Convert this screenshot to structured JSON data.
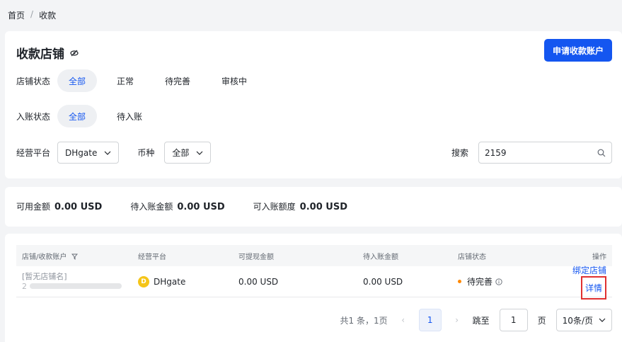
{
  "breadcrumb": {
    "home": "首页",
    "sep": "/",
    "current": "收款"
  },
  "header": {
    "title": "收款店铺",
    "apply_label": "申请收款账户"
  },
  "filters": {
    "shop_status_label": "店铺状态",
    "shop_status_options": [
      "全部",
      "正常",
      "待完善",
      "审核中"
    ],
    "entry_status_label": "入账状态",
    "entry_status_options": [
      "全部",
      "待入账"
    ],
    "platform_label": "经营平台",
    "platform_value": "DHgate",
    "currency_label": "币种",
    "currency_value": "全部",
    "search_label": "搜索",
    "search_value": "2159"
  },
  "balances": [
    {
      "label": "可用金额",
      "value": "0.00 USD"
    },
    {
      "label": "待入账金额",
      "value": "0.00 USD"
    },
    {
      "label": "可入账额度",
      "value": "0.00 USD"
    }
  ],
  "table": {
    "columns": [
      "店铺/收款账户",
      "经营平台",
      "可提现金额",
      "待入账金额",
      "店铺状态",
      "操作"
    ],
    "rows": [
      {
        "shop": "[暂无店铺名]",
        "sub_prefix": "2",
        "platform_badge": "D",
        "platform": "DHgate",
        "withdrawable": "0.00 USD",
        "pending": "0.00 USD",
        "status": "待完善",
        "action_bind": "绑定店铺",
        "action_detail": "详情"
      }
    ]
  },
  "pagination": {
    "summary": "共1 条，1页",
    "current": "1",
    "jump_label": "跳至",
    "jump_value": "1",
    "page_unit": "页",
    "page_size": "10条/页"
  },
  "colors": {
    "primary": "#1456f0",
    "warning_dot": "#ff8800",
    "highlight": "#e03030"
  }
}
